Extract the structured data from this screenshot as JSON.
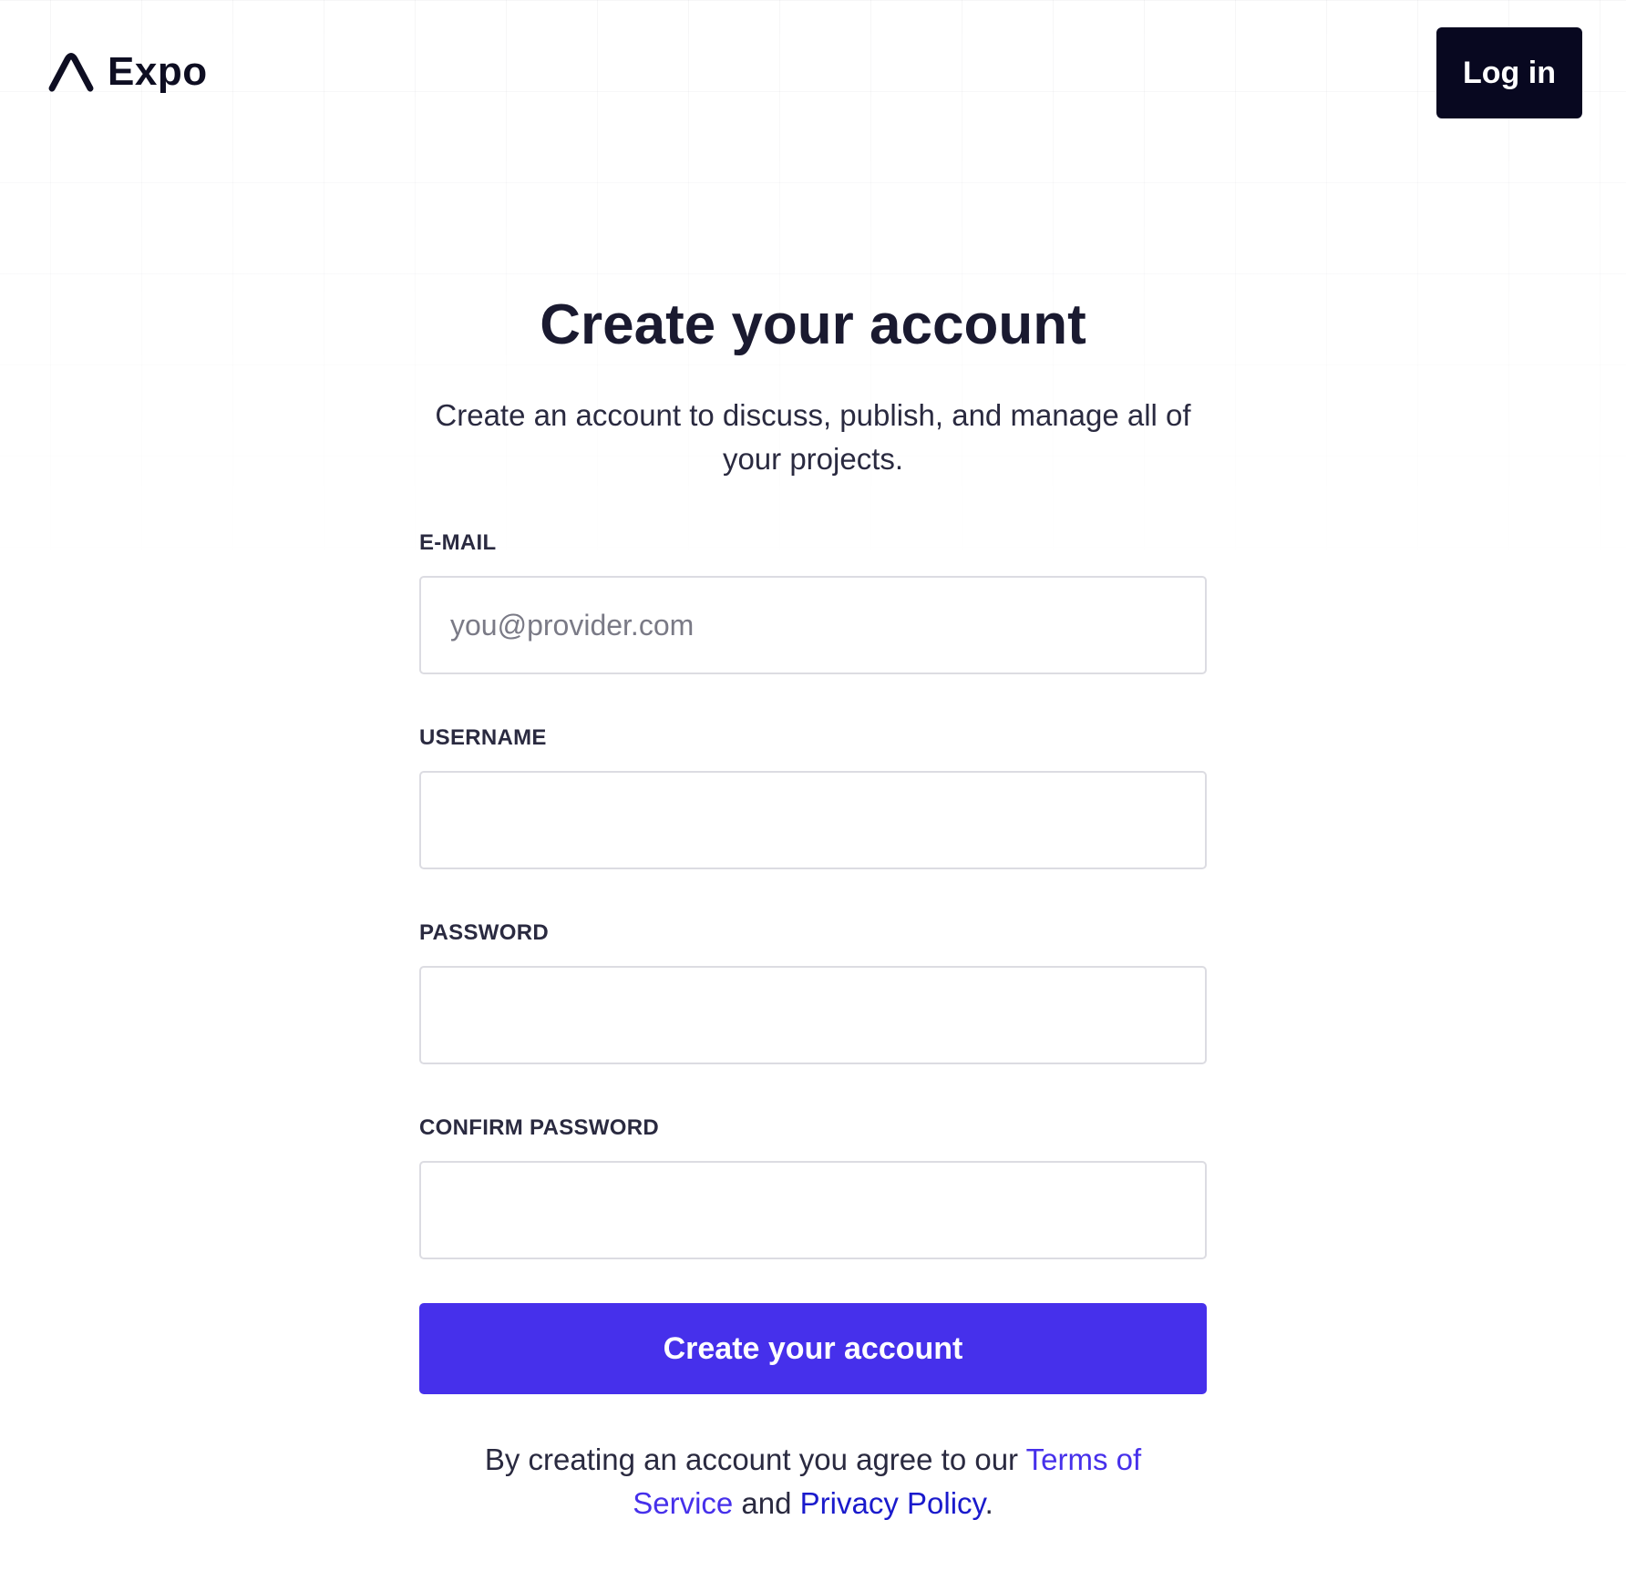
{
  "header": {
    "logo_text": "Expo",
    "login_label": "Log in"
  },
  "main": {
    "title": "Create your account",
    "subtitle": "Create an account to discuss, publish, and manage all of your projects.",
    "fields": {
      "email": {
        "label": "E-MAIL",
        "placeholder": "you@provider.com",
        "value": ""
      },
      "username": {
        "label": "USERNAME",
        "placeholder": "",
        "value": ""
      },
      "password": {
        "label": "PASSWORD",
        "placeholder": "",
        "value": ""
      },
      "confirm_password": {
        "label": "CONFIRM PASSWORD",
        "placeholder": "",
        "value": ""
      }
    },
    "submit_label": "Create your account"
  },
  "terms": {
    "prefix": "By creating an account you agree to our ",
    "terms_link": "Terms of Service",
    "middle": " and ",
    "privacy_link": "Privacy Policy",
    "suffix": "."
  },
  "colors": {
    "accent": "#4630eb",
    "dark_button": "#080820",
    "text": "#1a1a30"
  },
  "icons": {
    "logo": "expo-logo-icon"
  }
}
